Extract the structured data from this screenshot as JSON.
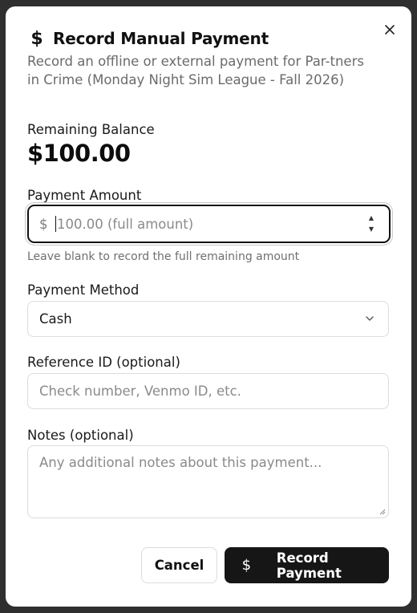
{
  "dialog": {
    "title": "Record Manual Payment",
    "title_icon": "dollar-sign-icon",
    "subtitle": "Record an offline or external payment for Par-tners in Crime (Monday Night Sim League - Fall 2026)",
    "close_icon": "close-icon"
  },
  "balance": {
    "label": "Remaining Balance",
    "value": "$100.00"
  },
  "payment_amount": {
    "label": "Payment Amount",
    "prefix": "$",
    "placeholder": "100.00 (full amount)",
    "hint": "Leave blank to record the full remaining amount"
  },
  "payment_method": {
    "label": "Payment Method",
    "selected": "Cash"
  },
  "reference_id": {
    "label": "Reference ID (optional)",
    "placeholder": "Check number, Venmo ID, etc."
  },
  "notes": {
    "label": "Notes (optional)",
    "placeholder": "Any additional notes about this payment..."
  },
  "actions": {
    "cancel_label": "Cancel",
    "record_label": "Record Payment",
    "record_icon": "dollar-sign-icon"
  }
}
